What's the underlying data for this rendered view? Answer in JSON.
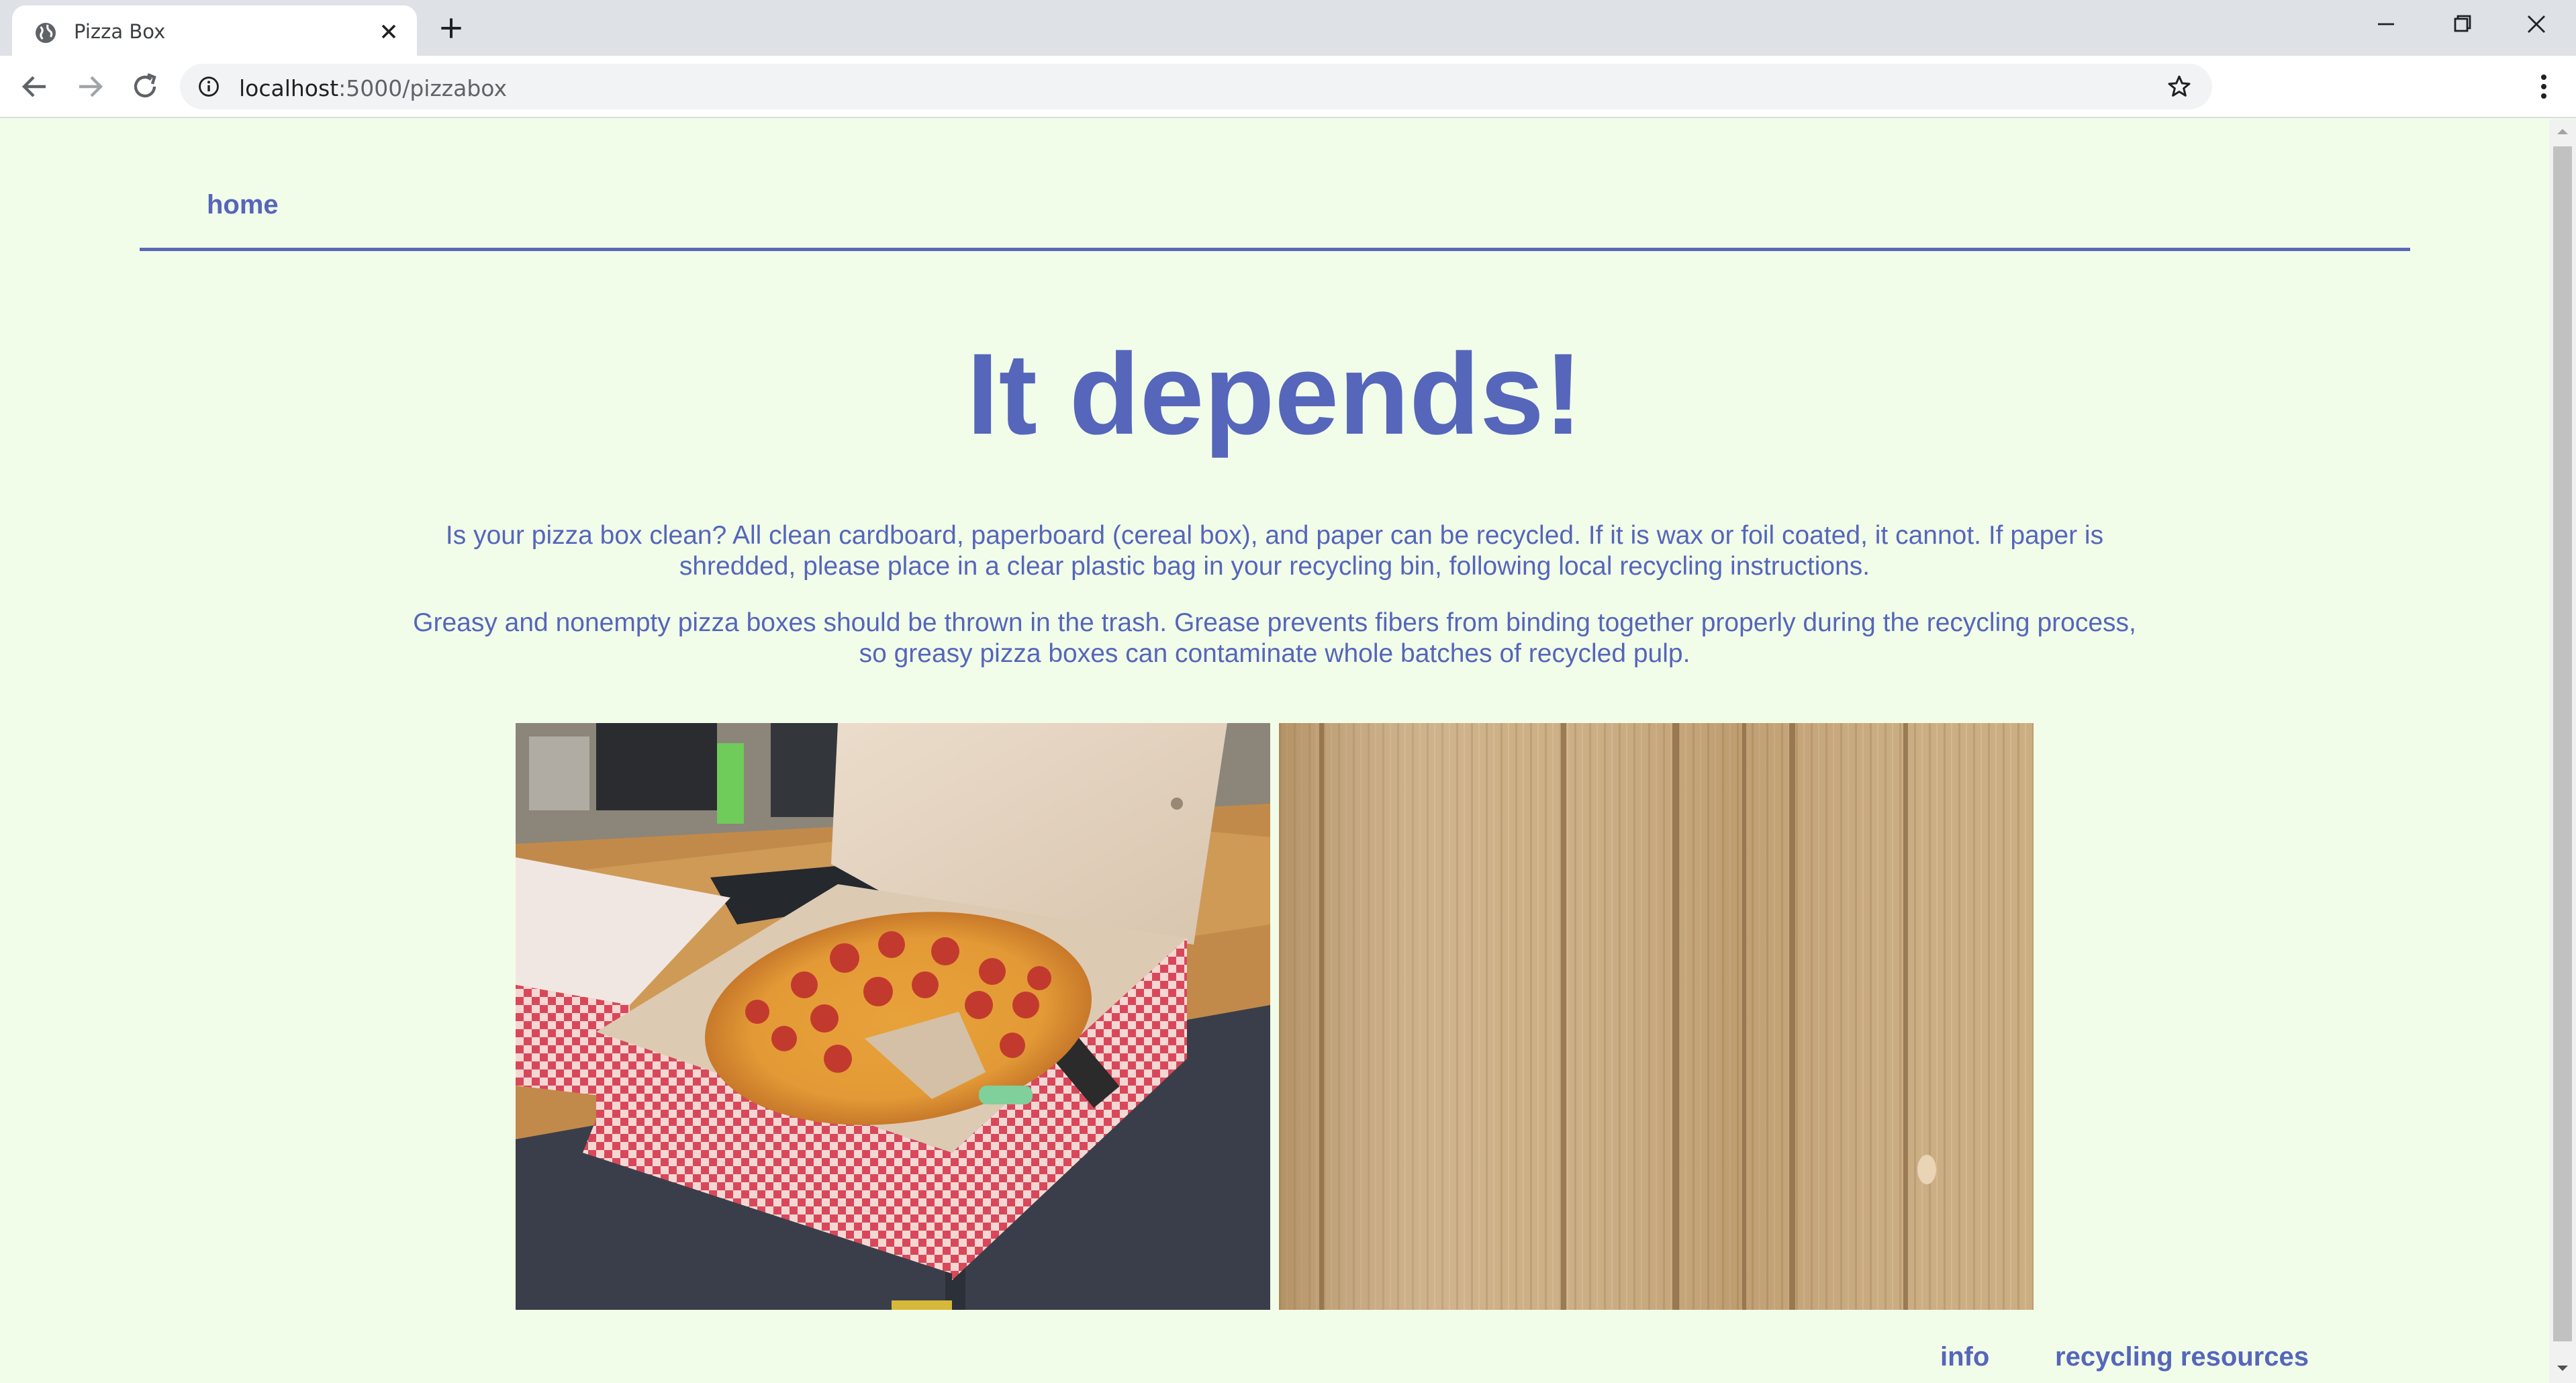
{
  "browser": {
    "tab_title": "Pizza Box",
    "url_host": "localhost",
    "url_path": ":5000/pizzabox"
  },
  "nav": {
    "home_label": "home"
  },
  "main": {
    "headline": "It depends!",
    "paragraph1": "Is your pizza box clean? All clean cardboard, paperboard (cereal box), and paper can be recycled. If it is wax or foil coated, it cannot. If paper is shredded, please place in a clear plastic bag in your recycling bin, following local recycling instructions.",
    "paragraph2": "Greasy and nonempty pizza boxes should be thrown in the trash. Grease prevents fibers from binding together properly during the recycling process, so greasy pizza boxes can contaminate whole batches of recycled pulp."
  },
  "footer": {
    "info_label": "info",
    "resources_label": "recycling resources"
  },
  "colors": {
    "page_background": "#f2fde9",
    "accent": "#5566bb"
  },
  "icons": [
    "globe-icon",
    "close-icon",
    "plus-icon",
    "minimize-icon",
    "restore-icon",
    "back-arrow-icon",
    "forward-arrow-icon",
    "reload-icon",
    "info-icon",
    "star-icon",
    "kebab-menu-icon"
  ]
}
